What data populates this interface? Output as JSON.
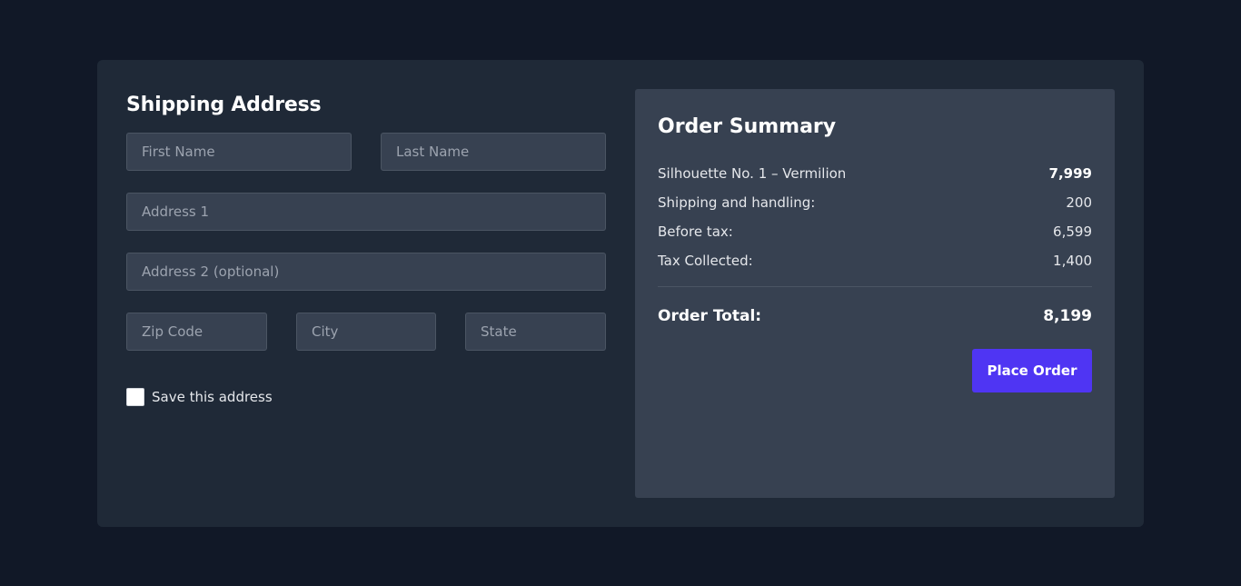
{
  "shipping": {
    "title": "Shipping Address",
    "fields": {
      "first_name": "First Name",
      "last_name": "Last Name",
      "address1": "Address 1",
      "address2": "Address 2 (optional)",
      "zip": "Zip Code",
      "city": "City",
      "state": "State"
    },
    "save_label": "Save this address",
    "save_checked": false
  },
  "summary": {
    "title": "Order Summary",
    "rows": [
      {
        "label": "Silhouette No. 1 – Vermilion",
        "value": "7,999"
      },
      {
        "label": "Shipping and handling:",
        "value": "200"
      },
      {
        "label": "Before tax:",
        "value": "6,599"
      },
      {
        "label": "Tax Collected:",
        "value": "1,400"
      }
    ],
    "total_label": "Order Total:",
    "total_value": "8,199",
    "button_label": "Place Order"
  },
  "colors": {
    "page_bg": "#111827",
    "card_bg": "#1f2937",
    "panel_bg": "#374151",
    "accent": "#4f35f3"
  }
}
